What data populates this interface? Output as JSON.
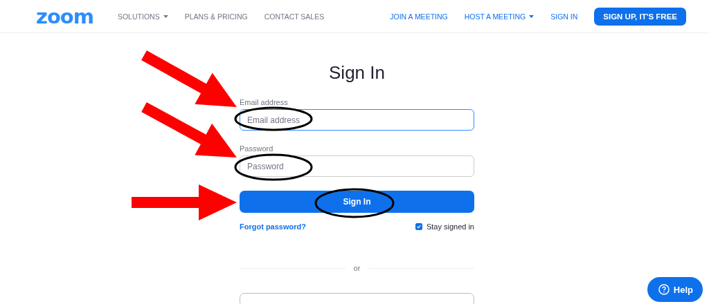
{
  "header": {
    "logo": "zoom",
    "left_links": [
      {
        "label": "SOLUTIONS",
        "dropdown": true
      },
      {
        "label": "PLANS & PRICING",
        "dropdown": false
      },
      {
        "label": "CONTACT SALES",
        "dropdown": false
      }
    ],
    "right_links": [
      {
        "label": "JOIN A MEETING",
        "dropdown": false
      },
      {
        "label": "HOST A MEETING",
        "dropdown": true
      },
      {
        "label": "SIGN IN",
        "dropdown": false
      }
    ],
    "cta": "SIGN UP, IT'S FREE"
  },
  "form": {
    "title": "Sign In",
    "fields": [
      {
        "label": "Email address",
        "placeholder": "Email address",
        "focused": true
      },
      {
        "label": "Password",
        "placeholder": "Password",
        "focused": false
      }
    ],
    "submit": "Sign In",
    "forgot": "Forgot password?",
    "stay_signed_in": {
      "label": "Stay signed in",
      "checked": true
    },
    "divider": "or"
  },
  "help": "Help"
}
